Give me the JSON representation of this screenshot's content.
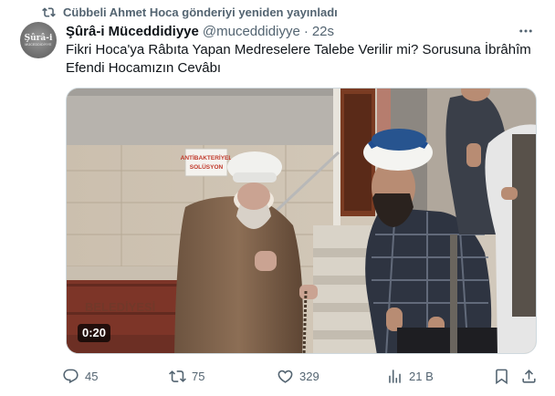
{
  "repost": {
    "text": "Cübbeli Ahmet Hoca gönderiyi yeniden yayınladı",
    "icon": "repost-icon"
  },
  "avatar": {
    "line1": "Şûrâ-i",
    "line2": "MÜCEDDİDİYYE"
  },
  "author": {
    "name": "Şûrâ-i Müceddidiyye",
    "handle": "@muceddidiyye",
    "separator": "·",
    "time": "22s"
  },
  "tweet": {
    "text": "Fikri Hoca'ya Râbıta Yapan Medreselere Talebe Verilir mi? Sorusuna İbrâhîm Efendi Hocamızın Cevâbı"
  },
  "media": {
    "duration": "0:20",
    "sign_line1": "ANTİBAKTERİYEL",
    "sign_line2": "SOLÜSYON",
    "bench_text": "BELEDİYESİ"
  },
  "actions": {
    "replies": "45",
    "reposts": "75",
    "likes": "329",
    "views": "21 B"
  },
  "colors": {
    "text": "#0f1419",
    "secondary": "#536471",
    "border": "#cfd9de"
  }
}
